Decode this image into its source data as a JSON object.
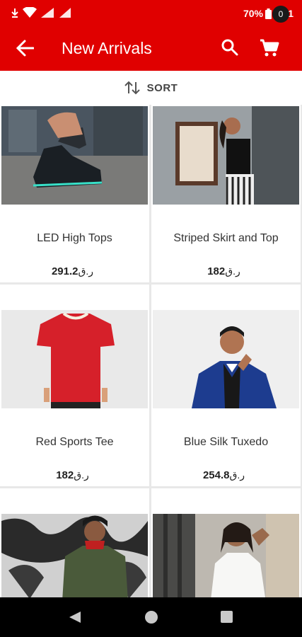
{
  "status_bar": {
    "battery": "70%",
    "time": "6:21"
  },
  "header": {
    "title": "New Arrivals",
    "cart_count": "0",
    "back_icon": "arrow-left-icon",
    "search_icon": "search-icon",
    "cart_icon": "shopping-cart-icon"
  },
  "sort": {
    "label": "SORT",
    "icon": "sort-arrows-icon"
  },
  "products": [
    {
      "name": "LED High Tops",
      "price": "291.2",
      "currency": "ر.ق",
      "image": "sneakers-photo"
    },
    {
      "name": "Striped Skirt and Top",
      "price": "182",
      "currency": "ر.ق",
      "image": "woman-street-photo"
    },
    {
      "name": "Red Sports Tee",
      "price": "182",
      "currency": "ر.ق",
      "image": "red-tshirt-photo"
    },
    {
      "name": "Blue Silk Tuxedo",
      "price": "254.8",
      "currency": "ر.ق",
      "image": "man-tuxedo-photo"
    },
    {
      "name": "",
      "price": "",
      "currency": "",
      "image": "man-graffiti-jacket-photo"
    },
    {
      "name": "",
      "price": "",
      "currency": "",
      "image": "woman-white-shirt-photo"
    }
  ],
  "colors": {
    "brand_red": "#e00000",
    "nav_black": "#000000"
  }
}
